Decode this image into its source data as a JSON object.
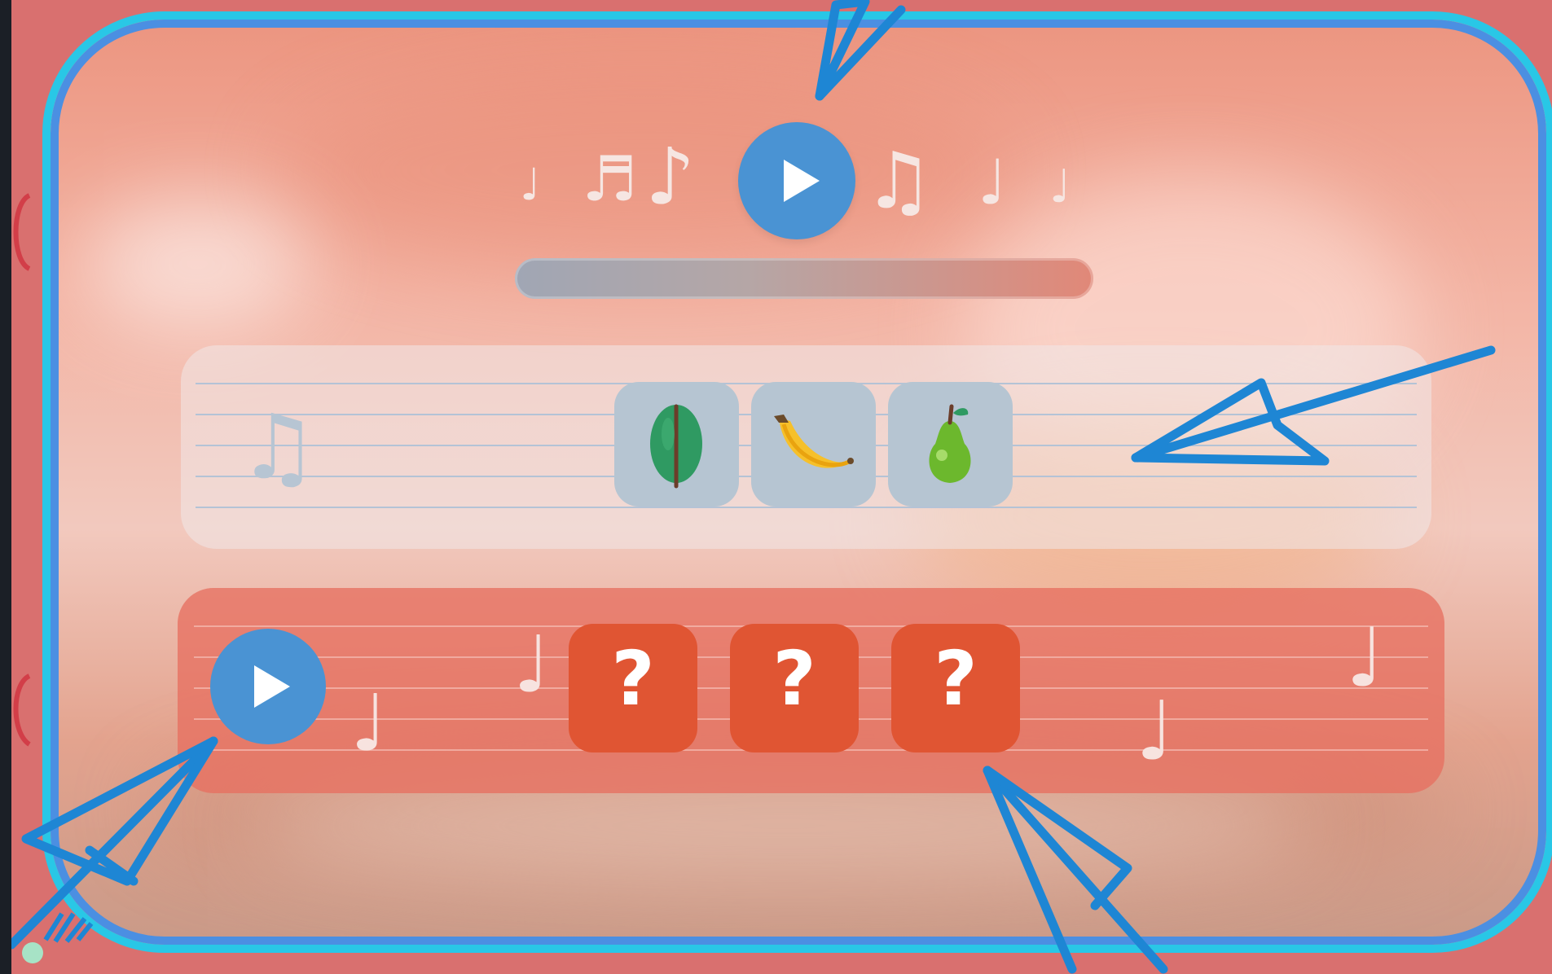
{
  "game": {
    "top_player": {
      "notes_left": [
        "♩",
        "♬",
        "♪"
      ],
      "notes_right": [
        "♫",
        "♩",
        "♩"
      ],
      "progress": 0
    },
    "answer_row": {
      "staff_icon": "♫",
      "cards": [
        {
          "icon": "leaf-icon"
        },
        {
          "icon": "banana-icon"
        },
        {
          "icon": "pear-icon"
        }
      ]
    },
    "question_row": {
      "cards": [
        {
          "label": "?"
        },
        {
          "label": "?"
        },
        {
          "label": "?"
        }
      ],
      "notes": [
        "♩",
        "♩",
        "♩",
        "♩"
      ]
    }
  },
  "colors": {
    "frame_outer": "#29c7e6",
    "frame_inner": "#4b8fe2",
    "play_button": "#4a93d3",
    "question_card": "#e05533",
    "answer_card": "#b6c5d2",
    "annotation": "#1e86d4"
  }
}
